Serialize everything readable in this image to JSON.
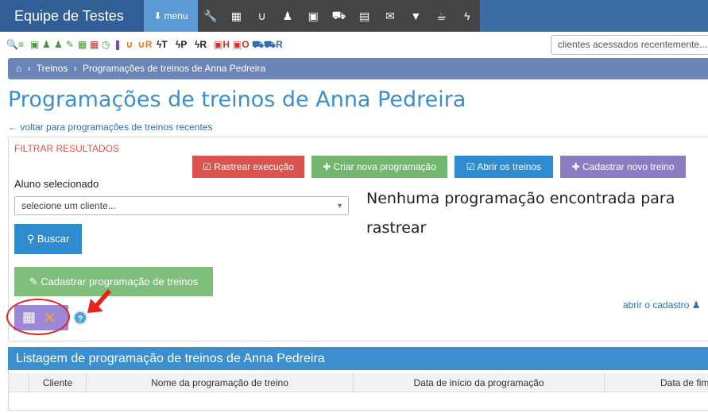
{
  "app": {
    "title": "Equipe de Testes",
    "menu_label": "menu"
  },
  "top_icons": [
    "wrench-icon",
    "calendar-icon",
    "stethoscope-icon",
    "users-icon",
    "money-icon",
    "cart-icon",
    "file-icon",
    "envelope-icon",
    "filter-icon",
    "coffee-icon",
    "bolt-icon"
  ],
  "toolbar2": {
    "items": [
      {
        "icon": "search-icon",
        "glyph": "🔍",
        "color": "#4a9a3a",
        "label": ""
      },
      {
        "icon": "list-icon",
        "glyph": "≡",
        "color": "#4a9a3a",
        "label": ""
      },
      {
        "icon": "money-icon",
        "glyph": "▣",
        "color": "#4a9a3a",
        "label": ""
      },
      {
        "icon": "user-icon",
        "glyph": "♟",
        "color": "#4a9a3a",
        "label": ""
      },
      {
        "icon": "users-icon",
        "glyph": "♟",
        "color": "#4a9a3a",
        "label": ""
      },
      {
        "icon": "pencil-icon",
        "glyph": "✎",
        "color": "#4a9a3a",
        "label": ""
      },
      {
        "icon": "calendar-icon",
        "glyph": "▦",
        "color": "#4a9a3a",
        "label": ""
      },
      {
        "icon": "calendar-icon",
        "glyph": "▦",
        "color": "#c0392b",
        "label": ""
      },
      {
        "icon": "clock-icon",
        "glyph": "◷",
        "color": "#4a9a3a",
        "label": ""
      },
      {
        "icon": "bookmark-icon",
        "glyph": "❚",
        "color": "#8e44ad",
        "label": ""
      },
      {
        "icon": "stethoscope-icon",
        "glyph": "∪",
        "color": "#e67e22",
        "label": ""
      },
      {
        "icon": "stethoscope-icon",
        "glyph": "∪",
        "color": "#e67e22",
        "label": "R"
      },
      {
        "icon": "bolt-icon",
        "glyph": "ϟ",
        "color": "#222",
        "label": "T"
      },
      {
        "icon": "bolt-icon",
        "glyph": "ϟ",
        "color": "#222",
        "label": "P"
      },
      {
        "icon": "bolt-icon",
        "glyph": "ϟ",
        "color": "#222",
        "label": "R"
      },
      {
        "icon": "money-icon",
        "glyph": "▣",
        "color": "#c0392b",
        "label": "H"
      },
      {
        "icon": "money-icon",
        "glyph": "▣",
        "color": "#c0392b",
        "label": "O"
      },
      {
        "icon": "cart-icon",
        "glyph": "⛟",
        "color": "#2e6fb0",
        "label": ""
      },
      {
        "icon": "cart-icon",
        "glyph": "⛟",
        "color": "#2e6fb0",
        "label": "R"
      }
    ],
    "recent_placeholder": "clientes acessados recentemente..."
  },
  "breadcrumb": {
    "home": "⌂",
    "sep": "›",
    "level1": "Treinos",
    "level2": "Programações de treinos de Anna Pedreira"
  },
  "page": {
    "title": "Programações de treinos de Anna Pedreira",
    "back_link": "voltar para programações de treinos recentes"
  },
  "filter": {
    "title": "FILTRAR RESULTADOS",
    "btn_rastrear": "Rastrear execução",
    "btn_criar": "Criar nova programação",
    "btn_abrir": "Abrir os treinos",
    "btn_cadastrar_treino": "Cadastrar novo treino",
    "aluno_label": "Aluno selecionado",
    "aluno_value": "selecione um cliente...",
    "buscar": "Buscar",
    "empty_message": "Nenhuma programação encontrada para rastrear",
    "cadastrar_programacao": "Cadastrar programação de treinos",
    "abrir_cadastro": "abrir o cadastro"
  },
  "listing": {
    "title": "Listagem de programação de treinos de Anna Pedreira",
    "columns": [
      "Cliente",
      "Nome da programação de treino",
      "Data de início da programação",
      "Data de fim"
    ]
  },
  "colors": {
    "brand": "#2f5f95",
    "accent": "#3a8fcc",
    "danger": "#d9534f",
    "success": "#74b56f",
    "purple": "#8e7cc3"
  }
}
